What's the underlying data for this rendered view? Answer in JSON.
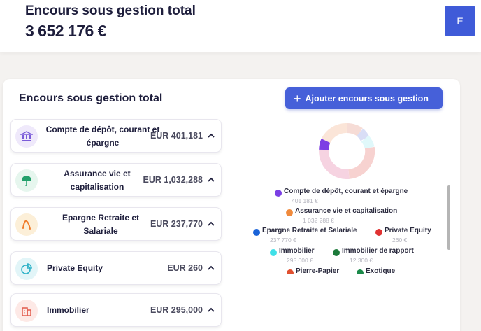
{
  "header": {
    "title": "Encours sous gestion total",
    "total": "3 652 176 €",
    "avatar_initial": "E"
  },
  "panel": {
    "title": "Encours sous gestion total",
    "add_button_label": "Ajouter encours sous gestion"
  },
  "cards": [
    {
      "label": "Compte de dépôt, courant et épargne",
      "amount": "EUR 401,181",
      "icon": "bank-icon",
      "color": "#7b5bd9"
    },
    {
      "label": "Assurance vie et capitalisation",
      "amount": "EUR 1,032,288",
      "icon": "umbrella-icon",
      "color": "#22a06b"
    },
    {
      "label": "Epargne Retraite et Salariale",
      "amount": "EUR 237,770",
      "icon": "trend-icon",
      "color": "#f07b2a"
    },
    {
      "label": "Private Equity",
      "amount": "EUR 260",
      "icon": "pie-icon",
      "color": "#2fb2c8"
    },
    {
      "label": "Immobilier",
      "amount": "EUR 295,000",
      "icon": "building-icon",
      "color": "#e25a4c"
    }
  ],
  "legend": [
    {
      "name": "Compte de dépôt, courant et épargne",
      "value": "401 181 €",
      "color": "#7b3fe4"
    },
    {
      "name": "Assurance vie et capitalisation",
      "value": "1 032 288 €",
      "color": "#f08a3c"
    },
    {
      "name": "Epargne Retraite et Salariale",
      "value": "237 770 €",
      "color": "#1a63d8"
    },
    {
      "name": "Private Equity",
      "value": "260 €",
      "color": "#e03232"
    },
    {
      "name": "Immobilier",
      "value": "295 000 €",
      "color": "#3fe0e8"
    },
    {
      "name": "Immobilier de rapport",
      "value": "12 300 €",
      "color": "#1c7a3a"
    },
    {
      "name": "Pierre-Papier",
      "value": "",
      "color": "#e05030"
    },
    {
      "name": "Exotique",
      "value": "",
      "color": "#1c8a4a"
    }
  ],
  "colors": {
    "accent": "#4660d9",
    "avatar": "#3f5bd8"
  }
}
